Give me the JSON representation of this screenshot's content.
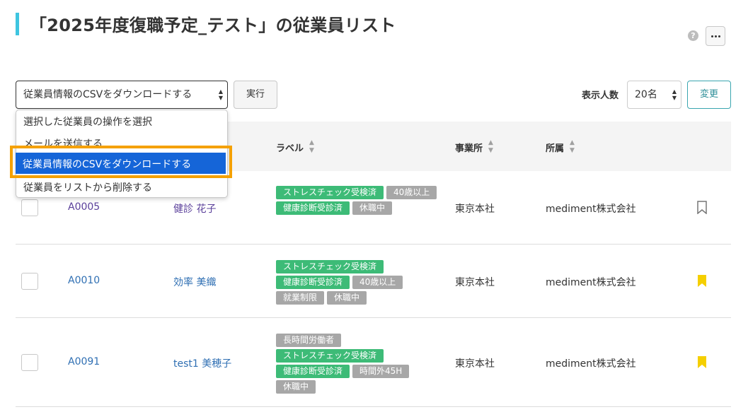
{
  "page": {
    "title": "「2025年度復職予定_テスト」の従業員リスト"
  },
  "toolbar": {
    "action_select_value": "従業員情報のCSVをダウンロードする",
    "run_label": "実行",
    "display_count_label": "表示人数",
    "display_count_value": "20名",
    "change_label": "変更",
    "help_label": "?"
  },
  "dropdown": {
    "options": [
      "選択した従業員の操作を選択",
      "メールを送信する",
      "従業員情報のCSVをダウンロードする",
      "従業員をリストから削除する"
    ],
    "selected": "従業員情報のCSVをダウンロードする"
  },
  "table": {
    "headers": {
      "label": "ラベル",
      "office": "事業所",
      "affiliation": "所属"
    },
    "rows": [
      {
        "id": "A0005",
        "name": "健診 花子",
        "labels": [
          {
            "text": "ストレスチェック受検済",
            "color": "#3dbb77"
          },
          {
            "text": "40歳以上",
            "color": "#a7a7a7"
          },
          {
            "text": "健康診断受診済",
            "color": "#3dbb77"
          },
          {
            "text": "休職中",
            "color": "#a7a7a7"
          }
        ],
        "office": "東京本社",
        "affiliation": "mediment株式会社",
        "bookmarked": false
      },
      {
        "id": "A0010",
        "name": "効率 美織",
        "labels": [
          {
            "text": "ストレスチェック受検済",
            "color": "#3dbb77"
          },
          {
            "text": "健康診断受診済",
            "color": "#3dbb77"
          },
          {
            "text": "40歳以上",
            "color": "#a7a7a7"
          },
          {
            "text": "就業制限",
            "color": "#a7a7a7"
          },
          {
            "text": "休職中",
            "color": "#a7a7a7"
          }
        ],
        "office": "東京本社",
        "affiliation": "mediment株式会社",
        "bookmarked": true
      },
      {
        "id": "A0091",
        "name": "test1 美穂子",
        "labels": [
          {
            "text": "長時間労働者",
            "color": "#a7a7a7"
          },
          {
            "text": "ストレスチェック受検済",
            "color": "#3dbb77"
          },
          {
            "text": "健康診断受診済",
            "color": "#3dbb77"
          },
          {
            "text": "時間外45H",
            "color": "#a7a7a7"
          },
          {
            "text": "休職中",
            "color": "#a7a7a7"
          }
        ],
        "office": "東京本社",
        "affiliation": "mediment株式会社",
        "bookmarked": true
      }
    ]
  },
  "colors": {
    "accent_bar": "#3ec5e0",
    "highlight_frame": "#f5a100",
    "selected_option": "#1565d8",
    "bookmark_on": "#f5cf00",
    "bookmark_off": "#777777"
  }
}
